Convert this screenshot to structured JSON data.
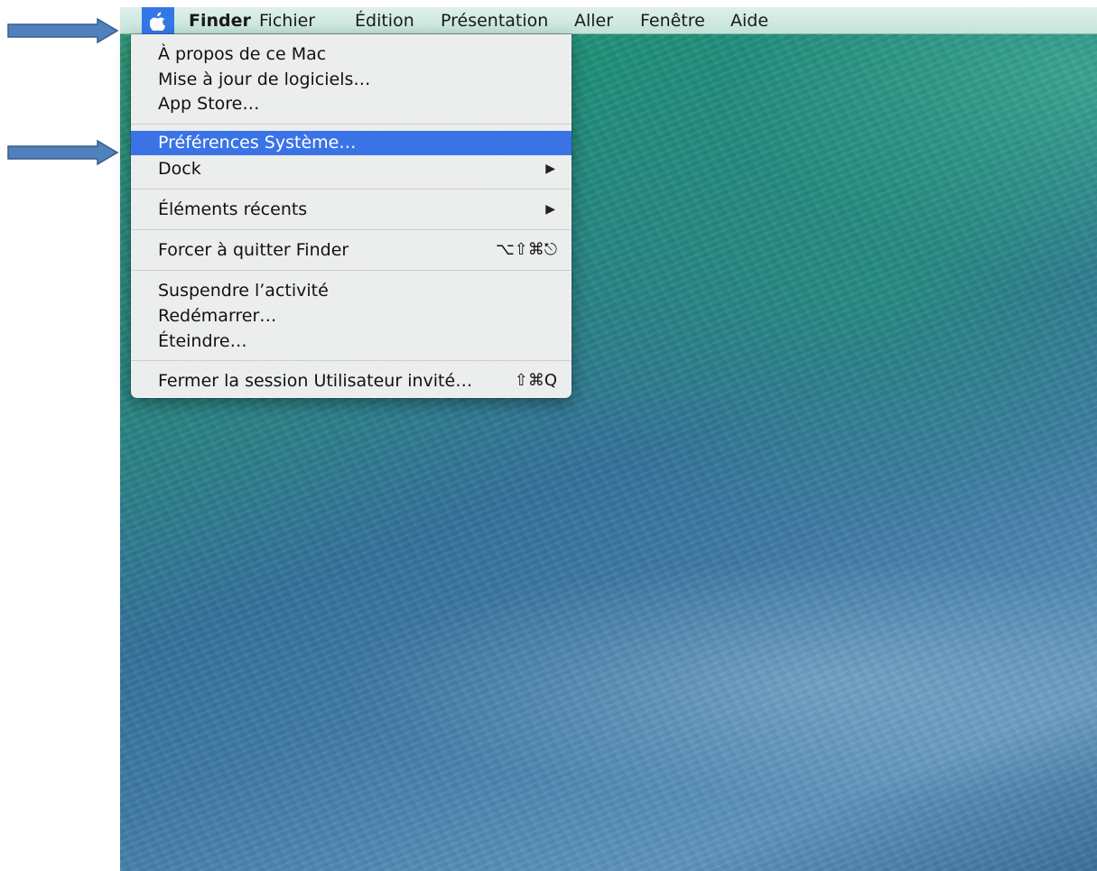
{
  "menubar": {
    "apple_icon": "apple-logo-icon",
    "app_name": "Finder",
    "menus": [
      "Fichier",
      "Édition",
      "Présentation",
      "Aller",
      "Fenêtre",
      "Aide"
    ]
  },
  "apple_menu": {
    "items": {
      "about": "À propos de ce Mac",
      "software_update": "Mise à jour de logiciels…",
      "app_store": "App Store…",
      "system_prefs": "Préférences Système…",
      "dock": "Dock",
      "recent_items": "Éléments récents",
      "force_quit": "Forcer à quitter Finder",
      "force_quit_shortcut": "⌥⇧⌘⎋",
      "sleep": "Suspendre l’activité",
      "restart": "Redémarrer…",
      "shutdown": "Éteindre…",
      "logout": "Fermer la session Utilisateur invité…",
      "logout_shortcut": "⇧⌘Q"
    },
    "highlighted": "Préférences Système…",
    "submenu_arrow_icon": "submenu-arrow-icon"
  },
  "colors": {
    "highlight": "#3a73e6",
    "annotation_arrow_fill": "#4f81bd",
    "annotation_arrow_stroke": "#385d8a"
  }
}
